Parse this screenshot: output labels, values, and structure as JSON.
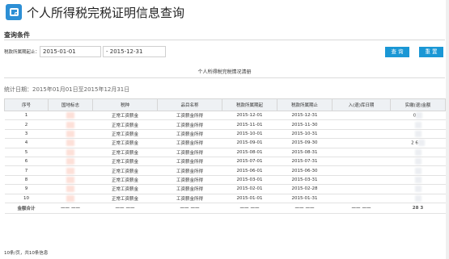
{
  "header": {
    "title": "个人所得税完税证明信息查询"
  },
  "query": {
    "section_title": "查询条件",
    "label": "税款所属期起止：",
    "start": "2015-01-01",
    "end": "- 2015-12-31",
    "query_btn": "查 询",
    "reset_btn": "重 置"
  },
  "list": {
    "title": "个人所得税完税情况清册",
    "stat": "统计日期：2015年01月01日至2015年12月31日",
    "columns": [
      "序号",
      "国地标志",
      "税种",
      "品目名称",
      "税款所属期起",
      "税款所属期止",
      "入(退)库日期",
      "实缴(退)金额"
    ],
    "rows": [
      [
        "1",
        "",
        "正常工资薪金",
        "工资薪金所得",
        "2015-12-01",
        "2015-12-31",
        "",
        "0"
      ],
      [
        "2",
        "",
        "正常工资薪金",
        "工资薪金所得",
        "2015-11-01",
        "2015-11-30",
        "",
        ""
      ],
      [
        "3",
        "",
        "正常工资薪金",
        "工资薪金所得",
        "2015-10-01",
        "2015-10-31",
        "",
        ""
      ],
      [
        "4",
        "",
        "正常工资薪金",
        "工资薪金所得",
        "2015-09-01",
        "2015-09-30",
        "",
        "2 6"
      ],
      [
        "5",
        "",
        "正常工资薪金",
        "工资薪金所得",
        "2015-08-01",
        "2015-08-31",
        "",
        ""
      ],
      [
        "6",
        "",
        "正常工资薪金",
        "工资薪金所得",
        "2015-07-01",
        "2015-07-31",
        "",
        ""
      ],
      [
        "7",
        "",
        "正常工资薪金",
        "工资薪金所得",
        "2015-06-01",
        "2015-06-30",
        "",
        ""
      ],
      [
        "8",
        "",
        "正常工资薪金",
        "工资薪金所得",
        "2015-03-01",
        "2015-03-31",
        "",
        ""
      ],
      [
        "9",
        "",
        "正常工资薪金",
        "工资薪金所得",
        "2015-02-01",
        "2015-02-28",
        "",
        ""
      ],
      [
        "10",
        "",
        "正常工资薪金",
        "工资薪金所得",
        "2015-01-01",
        "2015-01-31",
        "",
        ""
      ]
    ],
    "total_label": "金额合计",
    "dash": "—— ——",
    "total_value": "28 3",
    "footer": "10条/页，共10条信息"
  },
  "colors": {
    "accent": "#1a97d5",
    "logo": "#2d8fd5"
  }
}
